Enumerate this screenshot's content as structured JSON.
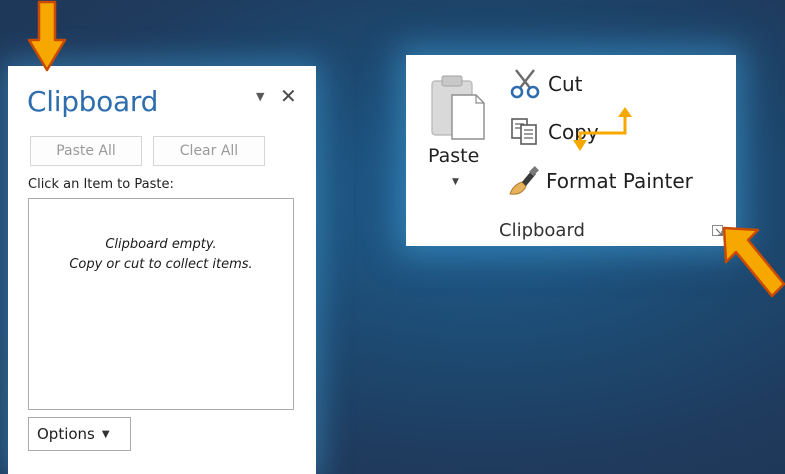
{
  "pane": {
    "title": "Clipboard",
    "paste_all_label": "Paste All",
    "clear_all_label": "Clear All",
    "items_label": "Click an Item to Paste:",
    "empty_line1": "Clipboard empty.",
    "empty_line2": "Copy or cut to collect items.",
    "options_label": "Options"
  },
  "ribbon": {
    "paste_label": "Paste",
    "cut_label": "Cut",
    "copy_label": "Copy",
    "format_painter_label": "Format Painter",
    "group_label": "Clipboard"
  },
  "icons": {
    "pane_menu": "chevron-down-icon",
    "pane_close": "close-icon",
    "options_dropdown": "chevron-down-icon",
    "paste": "clipboard-paste-icon",
    "cut": "scissors-icon",
    "copy": "copy-icon",
    "format_painter": "paintbrush-icon",
    "dialog_launcher": "dialog-launcher-icon"
  },
  "colors": {
    "background": "#1e3656",
    "glow": "#46aae6",
    "pane_title": "#2e6eaf",
    "arrow_fill": "#f7a800",
    "arrow_stroke": "#c94a00"
  }
}
